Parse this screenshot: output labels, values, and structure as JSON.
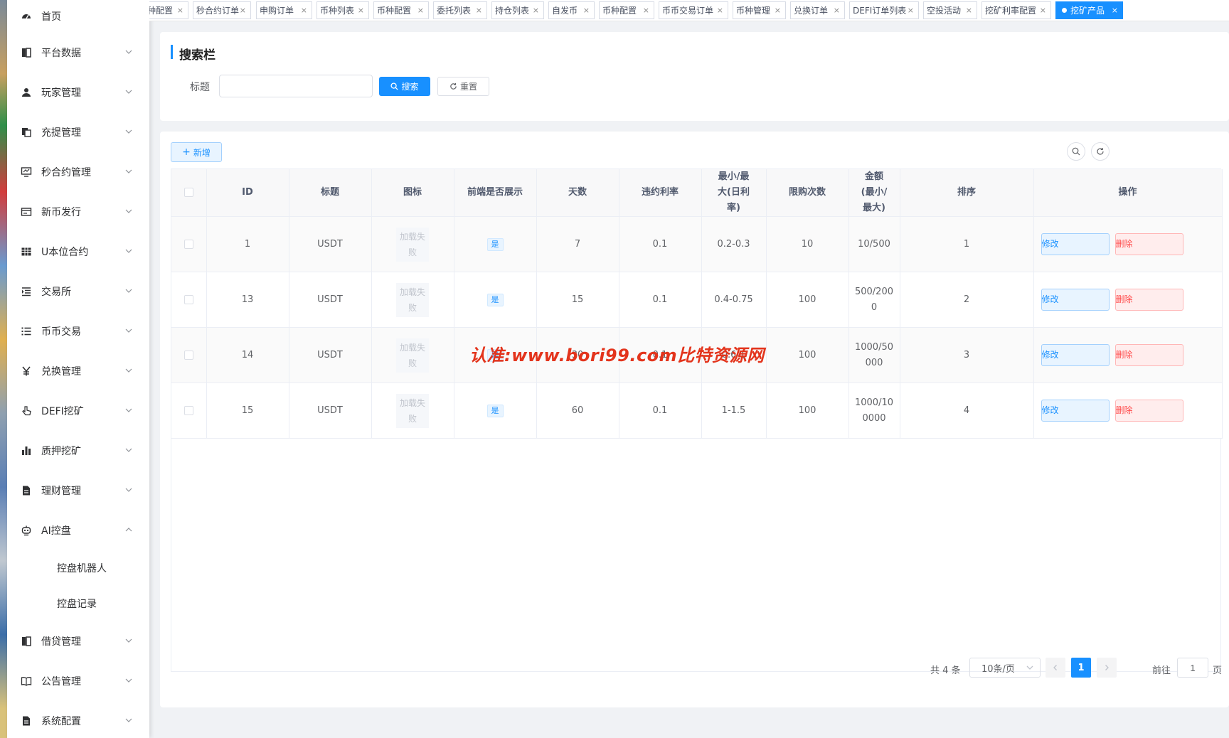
{
  "colors": {
    "primary": "#1890ff",
    "danger": "#ff4949",
    "watermark": "#e3341c"
  },
  "sidebar": {
    "items": [
      {
        "label": "首页",
        "icon": "dashboard-icon",
        "arrow": "none"
      },
      {
        "label": "平台数据",
        "icon": "book-icon",
        "arrow": "down"
      },
      {
        "label": "玩家管理",
        "icon": "user-icon",
        "arrow": "down"
      },
      {
        "label": "充提管理",
        "icon": "copy-icon",
        "arrow": "down"
      },
      {
        "label": "秒合约管理",
        "icon": "monitor-icon",
        "arrow": "down"
      },
      {
        "label": "新币发行",
        "icon": "card-icon",
        "arrow": "down"
      },
      {
        "label": "U本位合约",
        "icon": "table-icon",
        "arrow": "down"
      },
      {
        "label": "交易所",
        "icon": "list-indent-icon",
        "arrow": "down"
      },
      {
        "label": "币币交易",
        "icon": "list-icon",
        "arrow": "down"
      },
      {
        "label": "兑换管理",
        "icon": "yen-icon",
        "arrow": "down"
      },
      {
        "label": "DEFI挖矿",
        "icon": "pointer-icon",
        "arrow": "down"
      },
      {
        "label": "质押挖矿",
        "icon": "bar-chart-icon",
        "arrow": "down"
      },
      {
        "label": "理财管理",
        "icon": "document-icon",
        "arrow": "down"
      },
      {
        "label": "AI控盘",
        "icon": "robot-icon",
        "arrow": "up"
      }
    ],
    "sub_items": [
      {
        "label": "控盘机器人"
      },
      {
        "label": "控盘记录"
      }
    ],
    "items_after": [
      {
        "label": "借贷管理",
        "icon": "book-icon",
        "arrow": "down"
      },
      {
        "label": "公告管理",
        "icon": "open-book-icon",
        "arrow": "down"
      },
      {
        "label": "系统配置",
        "icon": "document-icon",
        "arrow": "down"
      }
    ]
  },
  "tabs": [
    {
      "label": "币种配置",
      "close": "×"
    },
    {
      "label": "秒合约订单",
      "close": "×"
    },
    {
      "label": "申购订单",
      "close": "×"
    },
    {
      "label": "币种列表",
      "close": "×"
    },
    {
      "label": "币种配置",
      "close": "×"
    },
    {
      "label": "委托列表",
      "close": "×"
    },
    {
      "label": "持仓列表",
      "close": "×"
    },
    {
      "label": "自发币",
      "close": "×"
    },
    {
      "label": "币种配置",
      "close": "×"
    },
    {
      "label": "币币交易订单",
      "close": "×"
    },
    {
      "label": "币种管理",
      "close": "×"
    },
    {
      "label": "兑换订单",
      "close": "×"
    },
    {
      "label": "DEFI订单列表",
      "close": "×"
    },
    {
      "label": "空投活动",
      "close": "×"
    },
    {
      "label": "挖矿利率配置",
      "close": "×"
    },
    {
      "label": "挖矿产品",
      "close": "×",
      "active": true
    }
  ],
  "search": {
    "section_title": "搜索栏",
    "field_label": "标题",
    "input_value": "",
    "search_button": "搜索",
    "reset_button": "重置"
  },
  "toolbar": {
    "add_button": "新增"
  },
  "table": {
    "columns": [
      "ID",
      "标题",
      "图标",
      "前端是否展示",
      "天数",
      "违约利率",
      "最小/最大(日利率)",
      "限购次数",
      "金额(最小/最大)",
      "排序",
      "操作"
    ],
    "rows": [
      {
        "id": "1",
        "title": "USDT",
        "icon_text": "加载失败",
        "show": "是",
        "days": "7",
        "penalty": "0.1",
        "rate": "0.2-0.3",
        "limit": "10",
        "amount": "10/500",
        "sort": "1"
      },
      {
        "id": "13",
        "title": "USDT",
        "icon_text": "加载失败",
        "show": "是",
        "days": "15",
        "penalty": "0.1",
        "rate": "0.4-0.75",
        "limit": "100",
        "amount": "500/2000",
        "sort": "2"
      },
      {
        "id": "14",
        "title": "USDT",
        "icon_text": "加载失败",
        "show": "是",
        "days": "30",
        "penalty": "0.1",
        "rate": "0.6-1",
        "limit": "100",
        "amount": "1000/50000",
        "sort": "3"
      },
      {
        "id": "15",
        "title": "USDT",
        "icon_text": "加载失败",
        "show": "是",
        "days": "60",
        "penalty": "0.1",
        "rate": "1-1.5",
        "limit": "100",
        "amount": "1000/100000",
        "sort": "4"
      }
    ],
    "edit_label": "修改",
    "delete_label": "删除"
  },
  "pagination": {
    "total": "共 4 条",
    "page_size": "10条/页",
    "current_page": "1",
    "goto_label": "前往",
    "goto_value": "1",
    "page_unit": "页"
  },
  "watermark": "认准:www.bori99.com比特资源网"
}
